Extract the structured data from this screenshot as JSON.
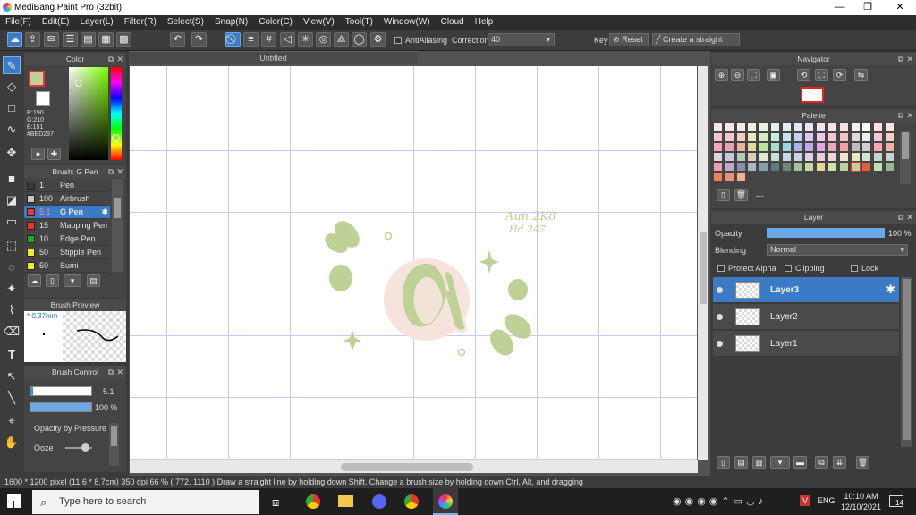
{
  "window": {
    "title": "MediBang Paint Pro (32bit)",
    "min": "—",
    "max": "❐",
    "close": "✕"
  },
  "menu": [
    "File(F)",
    "Edit(E)",
    "Layer(L)",
    "Filter(R)",
    "Select(S)",
    "Snap(N)",
    "Color(C)",
    "View(V)",
    "Tool(T)",
    "Window(W)",
    "Cloud",
    "Help"
  ],
  "toolbar": {
    "antialias": "AntiAliasing",
    "correction_label": "Correction",
    "correction_value": "40",
    "key": "Key",
    "reset": "Reset",
    "create_straight": "Create a straight"
  },
  "color_panel": {
    "title": "Color",
    "r": "R:190",
    "g": "G:210",
    "b": "B:151",
    "hex": "#BED297",
    "fg": "#bed297",
    "bg": "#ffffff"
  },
  "brush_panel": {
    "title": "Brush: G Pen",
    "items": [
      {
        "num": "1",
        "name": "Pen",
        "color": "#3a3a3a"
      },
      {
        "num": "100",
        "name": "Airbrush",
        "color": "#c8c8c8"
      },
      {
        "num": "5.1",
        "name": "G Pen",
        "color": "#e33"
      },
      {
        "num": "15",
        "name": "Mapping Pen",
        "color": "#e33"
      },
      {
        "num": "10",
        "name": "Edge Pen",
        "color": "#2a2"
      },
      {
        "num": "50",
        "name": "Stipple Pen",
        "color": "#ee2"
      },
      {
        "num": "50",
        "name": "Sumi",
        "color": "#ee2"
      }
    ]
  },
  "brush_preview": {
    "title": "Brush Preview",
    "size": "* 0.37mm"
  },
  "brush_control": {
    "title": "Brush Control",
    "size": "5.1",
    "opacity": "100 %",
    "pressure": "Opacity by Pressure",
    "ooze": "Ooze",
    "opacity_fraction": 1.0,
    "size_fraction": 0.05
  },
  "canvas": {
    "tab": "Untitled",
    "text1": "Aun 2K8",
    "text2": "Hd 247"
  },
  "navigator": {
    "title": "Navigator"
  },
  "palette": {
    "title": "Palette",
    "name": "---",
    "colors": [
      "#f5e6ee",
      "#f5e6e8",
      "#f4e9e4",
      "#f0efe2",
      "#e8f1e4",
      "#e3f1ec",
      "#e2eff3",
      "#e4e8f5",
      "#ebe4f5",
      "#f4e4f3",
      "#f5e4ea",
      "#f7e2e4",
      "#f2f2f2",
      "#ffffff",
      "#fde0e4",
      "#fbe3e0",
      "#f8c3d3",
      "#f5c6cc",
      "#f2cfc3",
      "#ede7c0",
      "#d8ecc4",
      "#c7ecdc",
      "#c5e6ef",
      "#c8d2f2",
      "#dac7f2",
      "#f0c7ee",
      "#f3c6d6",
      "#f6c1c4",
      "#dadada",
      "#ededed",
      "#fbc8cf",
      "#f7cdc6",
      "#f3a8bf",
      "#ef9fae",
      "#ebb39e",
      "#e2d99b",
      "#bde1a1",
      "#a3e0c7",
      "#a0d6e8",
      "#a6b6ea",
      "#c5a6ea",
      "#e6a6e3",
      "#eda6c0",
      "#f1a0a5",
      "#bdbdbd",
      "#cfcfcf",
      "#f8a9b6",
      "#f2b2a6",
      "#d8d8d8",
      "#c8c8d8",
      "#b8c8b8",
      "#d8d0c0",
      "#e0e8d0",
      "#c8e0d8",
      "#c8d8e8",
      "#d0d0e8",
      "#e0d0e8",
      "#e8d0e0",
      "#f0d8d8",
      "#f8e0d0",
      "#e8e8c8",
      "#d0e8c8",
      "#c0d8c8",
      "#c8d0d0",
      "#e8a0b0",
      "#c0a8c8",
      "#8890b0",
      "#a8b8c8",
      "#88a0a8",
      "#607880",
      "#708870",
      "#a8c098",
      "#c8d8a0",
      "#e8d890",
      "#d0e0a8",
      "#b8d0a0",
      "#bed297",
      "#e06040",
      "#c0e0b0",
      "#98b890",
      "#f08060",
      "#e89070",
      "#f0b090"
    ]
  },
  "layer_panel": {
    "title": "Layer",
    "opacity_label": "Opacity",
    "opacity_value": "100 %",
    "opacity_fraction": 1.0,
    "blending_label": "Blending",
    "blending_value": "Normal",
    "protect_alpha": "Protect Alpha",
    "clipping": "Clipping",
    "lock": "Lock",
    "layers": [
      {
        "name": "Layer3"
      },
      {
        "name": "Layer2"
      },
      {
        "name": "Layer1"
      }
    ]
  },
  "status": "1600 * 1200 pixel  (11.6 * 8.7cm)  350 dpi  66 %  ( 772, 1110 )  Draw a straight line by holding down Shift, Change a brush size by holding down Ctrl, Alt, and dragging",
  "taskbar": {
    "search": "Type here to search",
    "lang": "ENG",
    "time": "10:10 AM",
    "date": "12/10/2021",
    "notif": "14"
  }
}
